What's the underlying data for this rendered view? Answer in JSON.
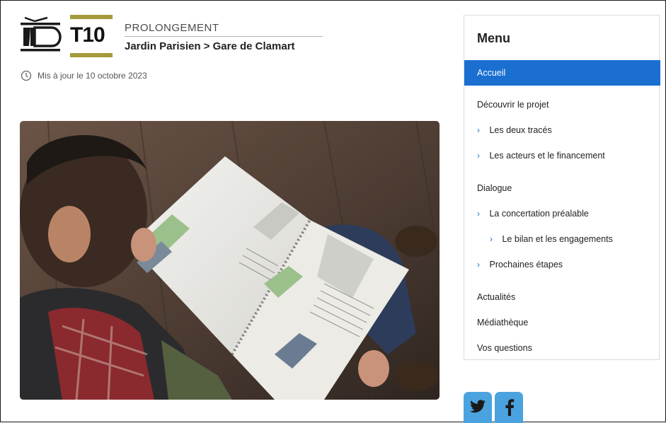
{
  "header": {
    "line_label": "T10",
    "subtitle": "PROLONGEMENT",
    "route": "Jardin Parisien > Gare de Clamart",
    "updated": "Mis à jour le 10 octobre 2023"
  },
  "colors": {
    "accent_blue": "#1a6fd1",
    "t10_olive": "#a59a3b",
    "social_blue": "#4aa3de"
  },
  "menu": {
    "title": "Menu",
    "items": [
      {
        "label": "Accueil",
        "active": true
      },
      {
        "label": "Découvrir le projet"
      },
      {
        "label": "Les deux tracés"
      },
      {
        "label": "Les acteurs et le financement"
      },
      {
        "label": "Dialogue"
      },
      {
        "label": "La concertation préalable"
      },
      {
        "label": "Le bilan et les engagements"
      },
      {
        "label": "Prochaines étapes"
      },
      {
        "label": "Actualités"
      },
      {
        "label": "Médiathèque"
      },
      {
        "label": "Vos questions"
      }
    ]
  },
  "social": [
    {
      "icon": "twitter-icon"
    },
    {
      "icon": "facebook-icon"
    }
  ]
}
